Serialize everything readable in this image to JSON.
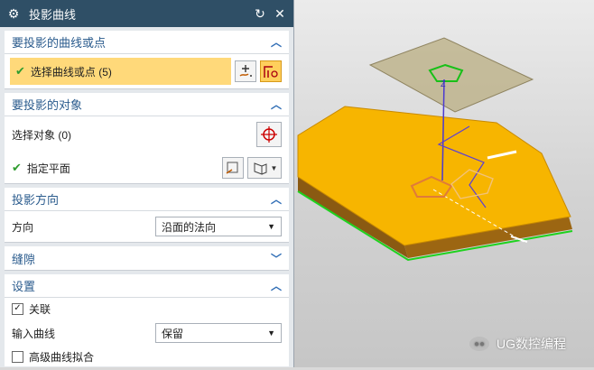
{
  "dialog": {
    "title": "投影曲线",
    "icon": "gear-icon",
    "reset_icon": "reset-icon",
    "close_icon": "close-icon"
  },
  "curves_group": {
    "header": "要投影的曲线或点",
    "select_label": "选择曲线或点 (5)"
  },
  "target_group": {
    "header": "要投影的对象",
    "select_label": "选择对象 (0)",
    "plane_label": "指定平面"
  },
  "direction_group": {
    "header": "投影方向",
    "direction_label": "方向",
    "direction_value": "沿面的法向"
  },
  "gap_group": {
    "header": "缝隙"
  },
  "settings_group": {
    "header": "设置",
    "associative_label": "关联",
    "associative_checked": true,
    "input_curve_label": "输入曲线",
    "input_curve_value": "保留",
    "advanced_fit_label": "高级曲线拟合",
    "advanced_fit_checked": false
  },
  "watermark": "UG数控编程",
  "colors": {
    "titlebar": "#2f4f66",
    "header_text": "#2a5b8d",
    "highlight": "#ffd97a",
    "solid_top": "#f7b500",
    "solid_edge": "#8a5a12"
  }
}
